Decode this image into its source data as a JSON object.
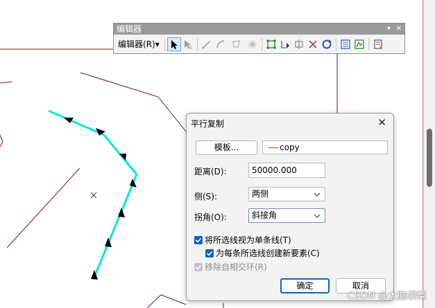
{
  "toolbar": {
    "title": "编辑器",
    "editor_menu_label": "编辑器(R)",
    "editor_menu_arrow": "▾",
    "dropdown_glyph": "▾",
    "close_glyph": "✕"
  },
  "dialog": {
    "title": "平行复制",
    "close_glyph": "✕",
    "template_button": "模板...",
    "template_value": "copy",
    "distance_label": "距离(D):",
    "distance_value": "50000.000",
    "side_label": "侧(S):",
    "side_value": "两侧",
    "corner_label": "拐角(O):",
    "corner_value": "斜接角",
    "option_treat_single": "将所选线视为单条线(T)",
    "option_create_new": "为每条所选线创建新要素(C)",
    "option_remove_loops": "移除自相交环(R)",
    "ok_button": "确定",
    "cancel_button": "取消"
  },
  "watermark": "CSDN @大脑袋梨",
  "colors": {
    "map_line": "#7a0f1e",
    "selected_line": "#00e5ee",
    "checkbox": "#0a63c8",
    "template_swatch": "#e03030",
    "toolbar_title_bg": "#9a9a9a"
  }
}
